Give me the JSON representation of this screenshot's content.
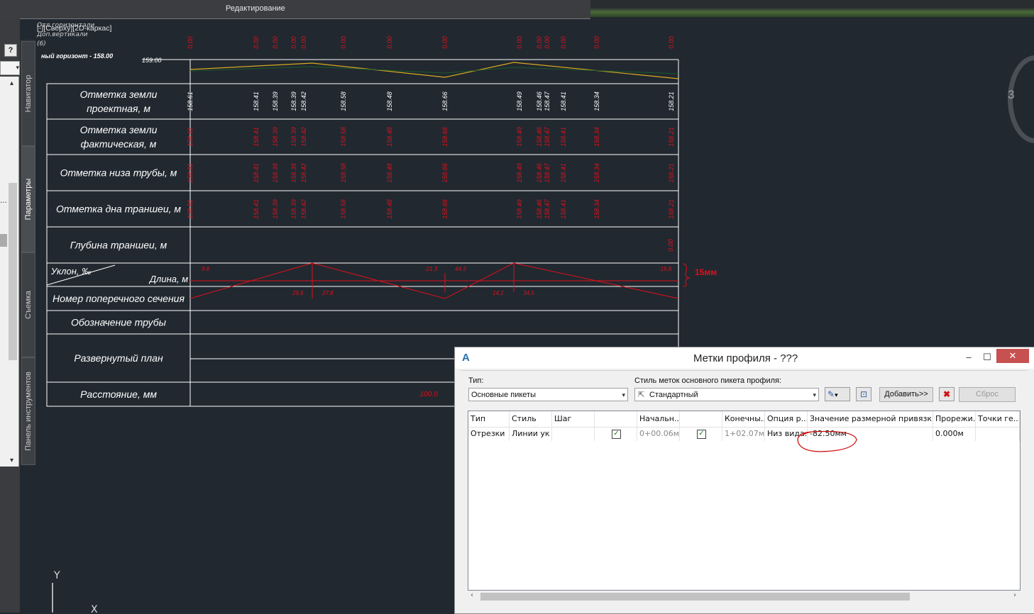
{
  "topbar": {
    "title": "Редактирование"
  },
  "left_tabs": [
    "Навигатор",
    "Параметры",
    "Съемка",
    "Панель инструментов"
  ],
  "left_panel": {
    "help": "?"
  },
  "viewport": {
    "label": "[-][Сверху][2D-каркас]",
    "scrap": [
      "Отл.горизонтали",
      "Доп.вертикали",
      "(6)"
    ],
    "nav_number": "3"
  },
  "profile": {
    "horizon": "ный горизонт - 158.00",
    "datum": "159.00",
    "rows": [
      {
        "label": "Отметка земли проектная, м",
        "lines": [
          "Отметка земли",
          "проектная, м"
        ]
      },
      {
        "label": "Отметка земли фактическая, м",
        "lines": [
          "Отметка земли",
          "фактическая, м"
        ]
      },
      {
        "label": "Отметка низа трубы, м",
        "lines": [
          "Отметка низа трубы, м"
        ]
      },
      {
        "label": "Отметка дна траншеи, м",
        "lines": [
          "Отметка дна траншеи, м"
        ]
      },
      {
        "label": "Глубина траншеи, м",
        "lines": [
          "Глубина траншеи, м"
        ]
      },
      {
        "label": "Уклон, ‰ / Длина, м",
        "lines": [
          "Уклон, ‰",
          "Длина, м"
        ]
      },
      {
        "label": "Номер поперечного сечения",
        "lines": [
          "Номер поперечного сечения"
        ]
      },
      {
        "label": "Обозначение трубы",
        "lines": [
          "Обозначение трубы"
        ]
      },
      {
        "label": "Развернутый план",
        "lines": [
          "Развернутый план"
        ]
      },
      {
        "label": "Расстояние, мм",
        "lines": [
          "Расстояние, мм"
        ]
      }
    ],
    "station_values": [
      "158.61",
      "158.41",
      "158.39",
      "158.39",
      "158.42",
      "158.58",
      "158.48",
      "158.66",
      "158.49",
      "158.46",
      "158.47",
      "158.41",
      "158.34",
      "158.21"
    ],
    "top_zeros": "0.00",
    "depth_value": "0.00",
    "slopes": [
      "9.8",
      "-21.3",
      "44.3",
      "-15.8"
    ],
    "lengths": [
      "25.6",
      "27.8",
      "14.2",
      "34.5"
    ],
    "distance": "100.0",
    "annotation": "15мм"
  },
  "dialog": {
    "title": "Метки профиля - ???",
    "type_label": "Тип:",
    "type_value": "Основные пикеты",
    "style_label": "Стиль меток основного пикета профиля:",
    "style_value": "Стандартный",
    "add_button": "Добавить>>",
    "reset_button": "Сброс",
    "columns": [
      "Тип",
      "Стиль",
      "Шаг",
      "",
      "Начальн...",
      "",
      "Конечны...",
      "Опция р...",
      "Значение размерной привязки",
      "Прорежи...",
      "Точки ге..."
    ],
    "row": {
      "type": "Отрезки",
      "style": "Линии ук",
      "step": "",
      "start_checked": true,
      "start": "0+00.06м",
      "end_checked": true,
      "end": "1+02.07м",
      "option": "Низ вида...",
      "dim_value": "-82.50мм",
      "thin": "0.000м",
      "geom": ""
    }
  },
  "colors": {
    "background": "#212830",
    "grid": "#ffffff",
    "red": "#e0101a",
    "yellow": "#d8a820",
    "highlight_circle": "#d01010"
  }
}
